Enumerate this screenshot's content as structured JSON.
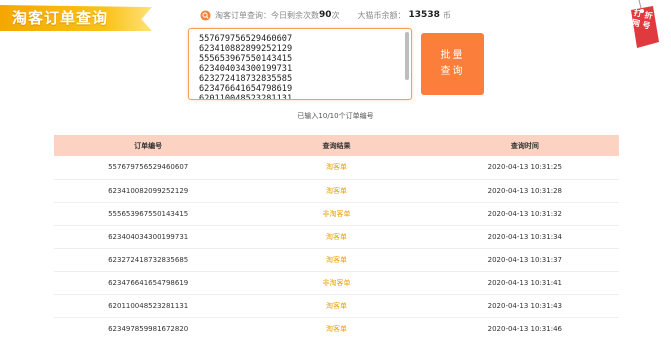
{
  "header": {
    "title": "淘客订单查询",
    "stats_prefix": "淘客订单查询：今日剩余次数",
    "remaining": "90",
    "stats_unit": "次",
    "balance_label": "大猫币余额：",
    "balance": "13538",
    "balance_unit": "币"
  },
  "tag": {
    "label": "打 折 网 号"
  },
  "order_input": {
    "lines": [
      "557679756529460607",
      "623410882899252129",
      "555653967550143415",
      "623404034300199731",
      "623272418732835585",
      "623476641654798619",
      "620110048523281131"
    ]
  },
  "query_button": {
    "line1": "批量",
    "line2": "查询"
  },
  "count_text": "已输入10/10个订单编号",
  "table": {
    "headers": [
      "订单编号",
      "查询结果",
      "查询时间"
    ],
    "rows": [
      {
        "order": "557679756529460607",
        "result": "淘客单",
        "time": "2020-04-13 10:31:25"
      },
      {
        "order": "623410082099252129",
        "result": "淘客单",
        "time": "2020-04-13 10:31:28"
      },
      {
        "order": "555653967550143415",
        "result": "非淘客单",
        "time": "2020-04-13 10:31:32"
      },
      {
        "order": "623404034300199731",
        "result": "淘客单",
        "time": "2020-04-13 10:31:34"
      },
      {
        "order": "623272418732835685",
        "result": "淘客单",
        "time": "2020-04-13 10:31:37"
      },
      {
        "order": "623476641654798619",
        "result": "非淘客单",
        "time": "2020-04-13 10:31:41"
      },
      {
        "order": "620110048523281131",
        "result": "淘客单",
        "time": "2020-04-13 10:31:43"
      },
      {
        "order": "623497859981672820",
        "result": "淘客单",
        "time": "2020-04-13 10:31:46"
      }
    ]
  },
  "colors": {
    "accent": "#fb7e3b",
    "banner": "#f5a700",
    "table_header": "#fcd3c2",
    "status": "#e8a100",
    "tag": "#e0393e"
  }
}
